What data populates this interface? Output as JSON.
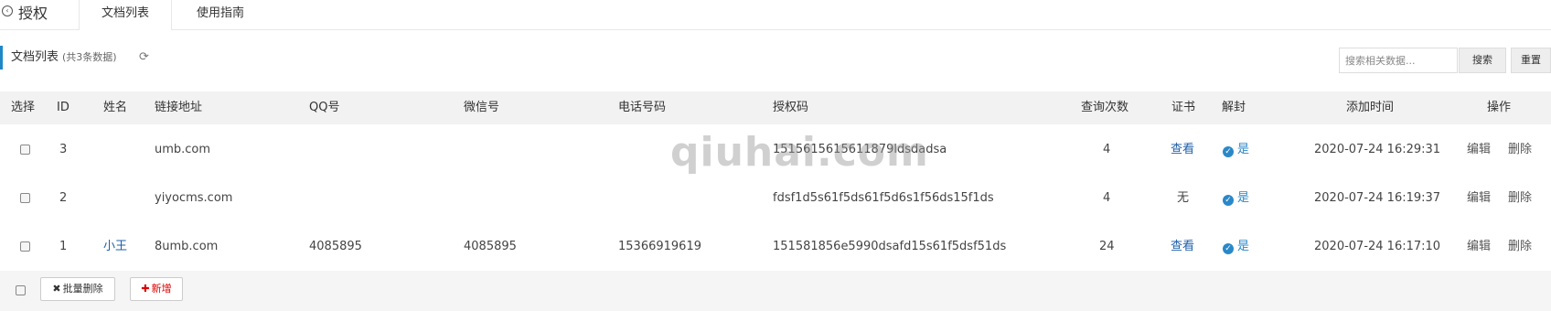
{
  "header": {
    "title": "授权",
    "tabs": [
      {
        "label": "文档列表",
        "active": true
      },
      {
        "label": "使用指南",
        "active": false
      }
    ]
  },
  "list": {
    "title": "文档列表",
    "count_text": "(共3条数据)",
    "search_placeholder": "搜索相关数据...",
    "search_label": "搜索",
    "reset_label": "重置"
  },
  "table": {
    "columns": [
      "选择",
      "ID",
      "姓名",
      "链接地址",
      "QQ号",
      "微信号",
      "电话号码",
      "授权码",
      "查询次数",
      "证书",
      "解封",
      "添加时间",
      "操作"
    ],
    "rows": [
      {
        "id": "3",
        "name": "",
        "url": "umb.com",
        "qq": "",
        "wechat": "",
        "phone": "",
        "code": "1515615615611879ldsdadsa",
        "queries": "4",
        "cert": "查看",
        "unlock": "是",
        "time": "2020-07-24 16:29:31",
        "edit": "编辑",
        "delete": "删除"
      },
      {
        "id": "2",
        "name": "",
        "url": "yiyocms.com",
        "qq": "",
        "wechat": "",
        "phone": "",
        "code": "fdsf1d5s61f5ds61f5d6s1f56ds15f1ds",
        "queries": "4",
        "cert": "无",
        "unlock": "是",
        "time": "2020-07-24 16:19:37",
        "edit": "编辑",
        "delete": "删除"
      },
      {
        "id": "1",
        "name": "小王",
        "url": "8umb.com",
        "qq": "4085895",
        "wechat": "4085895",
        "phone": "15366919619",
        "code": "151581856e5990dsafd15s61f5dsf51ds",
        "queries": "24",
        "cert": "查看",
        "unlock": "是",
        "time": "2020-07-24 16:17:10",
        "edit": "编辑",
        "delete": "删除"
      }
    ]
  },
  "footer": {
    "batch_delete_label": "批量删除",
    "add_label": "新增"
  },
  "watermark": "qiuhai.com",
  "colors": {
    "accent": "#1e88c7",
    "link": "#1e5fa8",
    "danger": "#dd0000"
  }
}
